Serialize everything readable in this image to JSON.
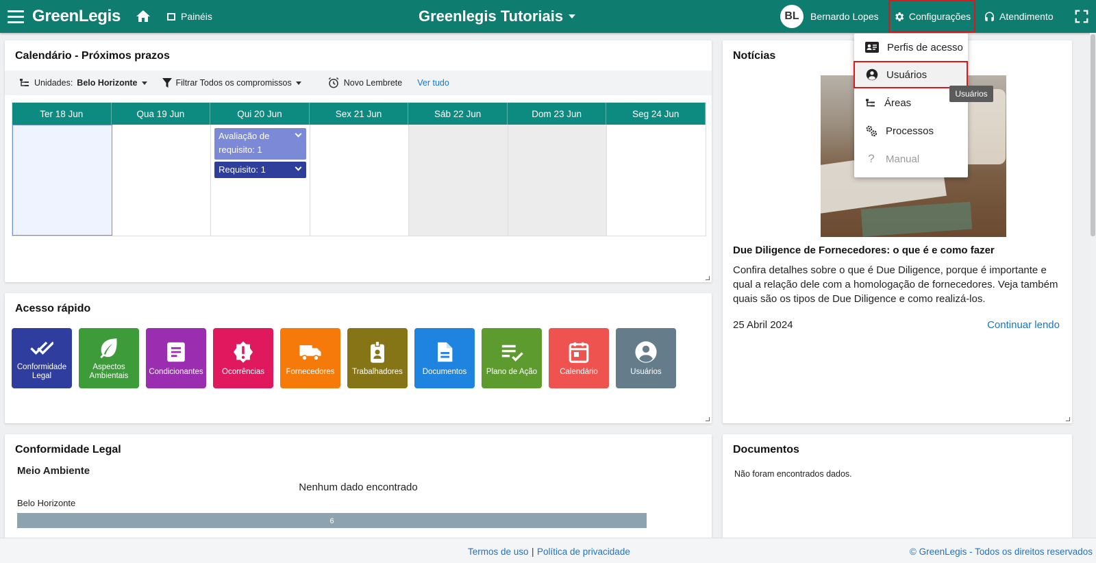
{
  "header": {
    "brand": "GreenLegis",
    "paineis": "Painéis",
    "title": "Greenlegis Tutoriais",
    "user_initials": "BL",
    "user_name": "Bernardo Lopes",
    "config": "Configurações",
    "atendimento": "Atendimento"
  },
  "calendar": {
    "title": "Calendário - Próximos prazos",
    "unidades_label": "Unidades:",
    "unidades_value": "Belo Horizonte",
    "filtrar": "Filtrar Todos os compromissos",
    "novo_lembrete": "Novo Lembrete",
    "ver_tudo": "Ver tudo",
    "days": [
      "Ter 18 Jun",
      "Qua 19 Jun",
      "Qui 20 Jun",
      "Sex 21 Jun",
      "Sáb 22 Jun",
      "Dom 23 Jun",
      "Seg 24 Jun"
    ],
    "events": [
      {
        "label": "Avaliação de requisito: 1",
        "color": "#7b89d6"
      },
      {
        "label": "Requisito: 1",
        "color": "#2e3e9a"
      }
    ]
  },
  "quick": {
    "title": "Acesso rápido",
    "tiles": [
      {
        "label": "Conformidade Legal",
        "color": "#2f3e9e",
        "icon": "double-check-icon"
      },
      {
        "label": "Aspectos Ambientais",
        "color": "#3e9b3a",
        "icon": "leaf-icon"
      },
      {
        "label": "Condicionantes",
        "color": "#9a2db0",
        "icon": "document-list-icon"
      },
      {
        "label": "Ocorrências",
        "color": "#e0185e",
        "icon": "alert-badge-icon"
      },
      {
        "label": "Fornecedores",
        "color": "#f57a0a",
        "icon": "truck-icon"
      },
      {
        "label": "Trabalhadores",
        "color": "#857516",
        "icon": "id-badge-icon"
      },
      {
        "label": "Documentos",
        "color": "#1e84e0",
        "icon": "file-icon"
      },
      {
        "label": "Plano de Ação",
        "color": "#5d9b2f",
        "icon": "checklist-icon"
      },
      {
        "label": "Calendário",
        "color": "#ef5350",
        "icon": "calendar-icon"
      },
      {
        "label": "Usuários",
        "color": "#657c8a",
        "icon": "account-circle-icon"
      }
    ]
  },
  "conformidade": {
    "title": "Conformidade Legal",
    "subtitle": "Meio Ambiente",
    "empty": "Nenhum dado encontrado",
    "bar_label": "Belo Horizonte",
    "bar_value": "6"
  },
  "news": {
    "title": "Notícias",
    "headline": "Due Diligence de Fornecedores: o que é e como fazer",
    "body": "Confira detalhes sobre o que é Due Diligence, porque é importante e qual a relação dele com a homologação de fornecedores. Veja também quais são os tipos de Due Diligence e como realizá-los.",
    "date": "25 Abril 2024",
    "more": "Continuar lendo"
  },
  "documents": {
    "title": "Documentos",
    "empty": "Não foram encontrados dados."
  },
  "menu": {
    "items": [
      "Perfis de acesso",
      "Usuários",
      "Áreas",
      "Processos",
      "Manual"
    ],
    "tooltip": "Usuários"
  },
  "footer": {
    "termos": "Termos de uso",
    "sep": "|",
    "politica": "Política de privacidade",
    "copyright": "© GreenLegis - Todos os direitos reservados"
  }
}
